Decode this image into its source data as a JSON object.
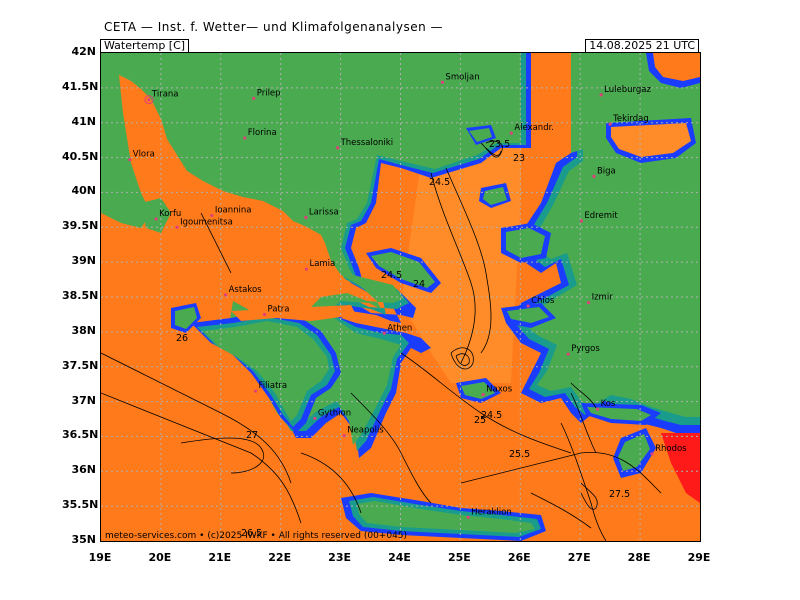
{
  "header": {
    "title": "CETA — Inst. f. Wetter— und Klimafolgenanalysen —",
    "parameter": "Watertemp [C]",
    "datetime": "14.08.2025  21 UTC"
  },
  "axes": {
    "lat_labels": [
      "42N",
      "41.5N",
      "41N",
      "40.5N",
      "40N",
      "39.5N",
      "39N",
      "38.5N",
      "38N",
      "37.5N",
      "37N",
      "36.5N",
      "36N",
      "35.5N",
      "35N"
    ],
    "lon_labels": [
      "19E",
      "20E",
      "21E",
      "22E",
      "23E",
      "24E",
      "25E",
      "26E",
      "27E",
      "28E",
      "29E"
    ]
  },
  "cities": [
    {
      "name": "Tirana",
      "lon": 19.8,
      "lat": 41.33
    },
    {
      "name": "Prilep",
      "lon": 21.55,
      "lat": 41.35
    },
    {
      "name": "Smoljan",
      "lon": 24.7,
      "lat": 41.58
    },
    {
      "name": "Luleburgaz",
      "lon": 27.35,
      "lat": 41.4
    },
    {
      "name": "Tekirdag",
      "lon": 27.5,
      "lat": 40.98
    },
    {
      "name": "Florina",
      "lon": 21.4,
      "lat": 40.78
    },
    {
      "name": "Thessaloniki",
      "lon": 22.95,
      "lat": 40.64
    },
    {
      "name": "Alexandr.",
      "lon": 25.85,
      "lat": 40.85
    },
    {
      "name": "Vlora",
      "lon": 19.48,
      "lat": 40.47
    },
    {
      "name": "Biga",
      "lon": 27.23,
      "lat": 40.23
    },
    {
      "name": "Korfu",
      "lon": 19.92,
      "lat": 39.62
    },
    {
      "name": "Ioannina",
      "lon": 20.85,
      "lat": 39.67
    },
    {
      "name": "Larissa",
      "lon": 22.42,
      "lat": 39.64
    },
    {
      "name": "Edremit",
      "lon": 27.02,
      "lat": 39.59
    },
    {
      "name": "Igoumenitsa",
      "lon": 20.27,
      "lat": 39.5
    },
    {
      "name": "Lamia",
      "lon": 22.43,
      "lat": 38.9
    },
    {
      "name": "Astakos",
      "lon": 21.08,
      "lat": 38.53
    },
    {
      "name": "Izmir",
      "lon": 27.14,
      "lat": 38.42
    },
    {
      "name": "Patra",
      "lon": 21.73,
      "lat": 38.25
    },
    {
      "name": "Chios",
      "lon": 26.13,
      "lat": 38.37
    },
    {
      "name": "Athen",
      "lon": 23.73,
      "lat": 37.98
    },
    {
      "name": "Pyrgos",
      "lon": 26.8,
      "lat": 37.68
    },
    {
      "name": "Filiatra",
      "lon": 21.58,
      "lat": 37.15
    },
    {
      "name": "Gythion",
      "lon": 22.57,
      "lat": 36.76
    },
    {
      "name": "Naxos",
      "lon": 25.38,
      "lat": 37.1
    },
    {
      "name": "Kos",
      "lon": 27.29,
      "lat": 36.89
    },
    {
      "name": "Neapolis",
      "lon": 23.06,
      "lat": 36.51
    },
    {
      "name": "Rhodos",
      "lon": 28.2,
      "lat": 36.25
    },
    {
      "name": "Heraklion",
      "lon": 25.13,
      "lat": 35.34
    }
  ],
  "contour_labels": [
    "23.5",
    "23",
    "24.5",
    "24.5",
    "24",
    "26",
    "27",
    "25",
    "24.5",
    "25.5",
    "27.5",
    "26.5"
  ],
  "copyright": "meteo-services.com • (c)2025 IWKF • All rights reserved (00+045)",
  "colors": {
    "land": "#4aaa50",
    "sea": "#ff7a1a",
    "sea_warm": "#ff8c28",
    "coast_blue": "#1a3cff",
    "coast_teal": "#1a9c8c",
    "hot": "#ff1a1a"
  }
}
